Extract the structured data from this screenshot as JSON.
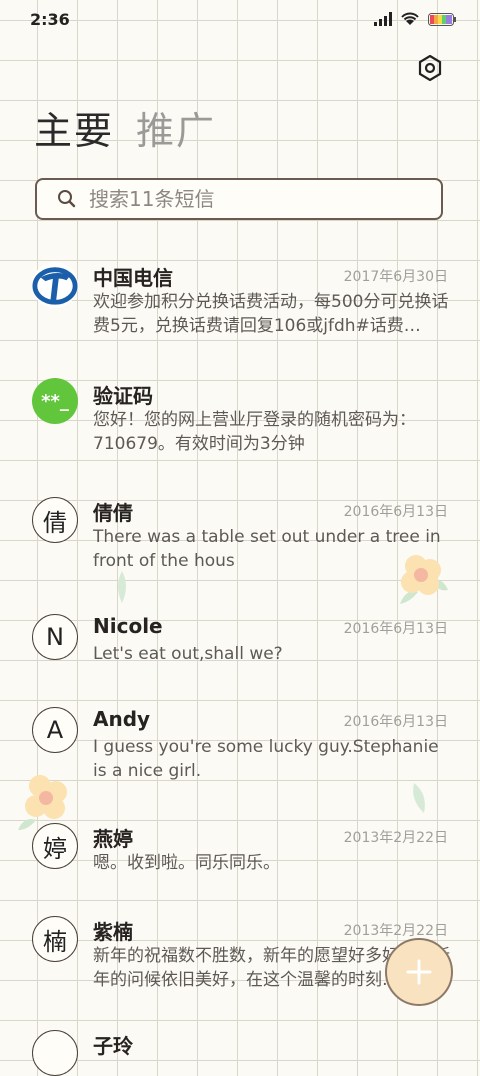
{
  "status": {
    "time": "2:36"
  },
  "tabs": [
    {
      "label": "主要",
      "active": true
    },
    {
      "label": "推广",
      "active": false
    }
  ],
  "search": {
    "placeholder": "搜索11条短信"
  },
  "conversations": [
    {
      "name": "中国电信",
      "date": "2017年6月30日",
      "preview": "欢迎参加积分兑换话费活动，每500分可兑换话费5元，兑换话费请回复106或jfdh#话费…",
      "avatar": "telecom-logo"
    },
    {
      "name": "验证码",
      "date": "",
      "preview": "您好！您的网上营业厅登录的随机密码为：710679。有效时间为3分钟",
      "avatar_text": "**_"
    },
    {
      "name": "倩倩",
      "date": "2016年6月13日",
      "preview": "There was a table set out under a tree in front of the hous",
      "avatar_text": "倩"
    },
    {
      "name": "Nicole",
      "date": "2016年6月13日",
      "preview": "Let's eat out,shall we?",
      "avatar_text": "N"
    },
    {
      "name": "Andy",
      "date": "2016年6月13日",
      "preview": "I guess you're some lucky guy.Stephanie is a nice girl.",
      "avatar_text": "A"
    },
    {
      "name": "燕婷",
      "date": "2013年2月22日",
      "preview": "嗯。收到啦。同乐同乐。",
      "avatar_text": "婷"
    },
    {
      "name": "紫楠",
      "date": "2013年2月22日",
      "preview": "新年的祝福数不胜数，新年的愿望好多好多，新年的问候依旧美好，在这个温馨的时刻…",
      "avatar_text": "楠"
    },
    {
      "name": "子玲",
      "date": "",
      "preview": "",
      "avatar_text": ""
    }
  ],
  "colors": {
    "accent": "#62c63c",
    "fab": "#f8e2bf",
    "grid": "#d9d7c9",
    "telecom_blue": "#1b5faa"
  },
  "icons": {
    "settings": "gear-icon",
    "search": "search-icon",
    "fab": "plus-icon"
  }
}
